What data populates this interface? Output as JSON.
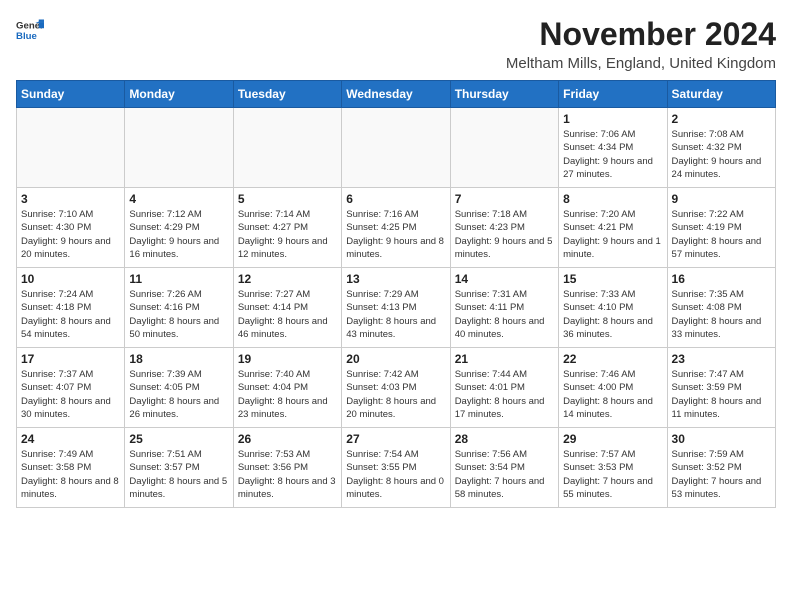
{
  "logo": {
    "text_general": "General",
    "text_blue": "Blue"
  },
  "header": {
    "month": "November 2024",
    "location": "Meltham Mills, England, United Kingdom"
  },
  "days_of_week": [
    "Sunday",
    "Monday",
    "Tuesday",
    "Wednesday",
    "Thursday",
    "Friday",
    "Saturday"
  ],
  "weeks": [
    [
      {
        "day": "",
        "info": ""
      },
      {
        "day": "",
        "info": ""
      },
      {
        "day": "",
        "info": ""
      },
      {
        "day": "",
        "info": ""
      },
      {
        "day": "",
        "info": ""
      },
      {
        "day": "1",
        "info": "Sunrise: 7:06 AM\nSunset: 4:34 PM\nDaylight: 9 hours and 27 minutes."
      },
      {
        "day": "2",
        "info": "Sunrise: 7:08 AM\nSunset: 4:32 PM\nDaylight: 9 hours and 24 minutes."
      }
    ],
    [
      {
        "day": "3",
        "info": "Sunrise: 7:10 AM\nSunset: 4:30 PM\nDaylight: 9 hours and 20 minutes."
      },
      {
        "day": "4",
        "info": "Sunrise: 7:12 AM\nSunset: 4:29 PM\nDaylight: 9 hours and 16 minutes."
      },
      {
        "day": "5",
        "info": "Sunrise: 7:14 AM\nSunset: 4:27 PM\nDaylight: 9 hours and 12 minutes."
      },
      {
        "day": "6",
        "info": "Sunrise: 7:16 AM\nSunset: 4:25 PM\nDaylight: 9 hours and 8 minutes."
      },
      {
        "day": "7",
        "info": "Sunrise: 7:18 AM\nSunset: 4:23 PM\nDaylight: 9 hours and 5 minutes."
      },
      {
        "day": "8",
        "info": "Sunrise: 7:20 AM\nSunset: 4:21 PM\nDaylight: 9 hours and 1 minute."
      },
      {
        "day": "9",
        "info": "Sunrise: 7:22 AM\nSunset: 4:19 PM\nDaylight: 8 hours and 57 minutes."
      }
    ],
    [
      {
        "day": "10",
        "info": "Sunrise: 7:24 AM\nSunset: 4:18 PM\nDaylight: 8 hours and 54 minutes."
      },
      {
        "day": "11",
        "info": "Sunrise: 7:26 AM\nSunset: 4:16 PM\nDaylight: 8 hours and 50 minutes."
      },
      {
        "day": "12",
        "info": "Sunrise: 7:27 AM\nSunset: 4:14 PM\nDaylight: 8 hours and 46 minutes."
      },
      {
        "day": "13",
        "info": "Sunrise: 7:29 AM\nSunset: 4:13 PM\nDaylight: 8 hours and 43 minutes."
      },
      {
        "day": "14",
        "info": "Sunrise: 7:31 AM\nSunset: 4:11 PM\nDaylight: 8 hours and 40 minutes."
      },
      {
        "day": "15",
        "info": "Sunrise: 7:33 AM\nSunset: 4:10 PM\nDaylight: 8 hours and 36 minutes."
      },
      {
        "day": "16",
        "info": "Sunrise: 7:35 AM\nSunset: 4:08 PM\nDaylight: 8 hours and 33 minutes."
      }
    ],
    [
      {
        "day": "17",
        "info": "Sunrise: 7:37 AM\nSunset: 4:07 PM\nDaylight: 8 hours and 30 minutes."
      },
      {
        "day": "18",
        "info": "Sunrise: 7:39 AM\nSunset: 4:05 PM\nDaylight: 8 hours and 26 minutes."
      },
      {
        "day": "19",
        "info": "Sunrise: 7:40 AM\nSunset: 4:04 PM\nDaylight: 8 hours and 23 minutes."
      },
      {
        "day": "20",
        "info": "Sunrise: 7:42 AM\nSunset: 4:03 PM\nDaylight: 8 hours and 20 minutes."
      },
      {
        "day": "21",
        "info": "Sunrise: 7:44 AM\nSunset: 4:01 PM\nDaylight: 8 hours and 17 minutes."
      },
      {
        "day": "22",
        "info": "Sunrise: 7:46 AM\nSunset: 4:00 PM\nDaylight: 8 hours and 14 minutes."
      },
      {
        "day": "23",
        "info": "Sunrise: 7:47 AM\nSunset: 3:59 PM\nDaylight: 8 hours and 11 minutes."
      }
    ],
    [
      {
        "day": "24",
        "info": "Sunrise: 7:49 AM\nSunset: 3:58 PM\nDaylight: 8 hours and 8 minutes."
      },
      {
        "day": "25",
        "info": "Sunrise: 7:51 AM\nSunset: 3:57 PM\nDaylight: 8 hours and 5 minutes."
      },
      {
        "day": "26",
        "info": "Sunrise: 7:53 AM\nSunset: 3:56 PM\nDaylight: 8 hours and 3 minutes."
      },
      {
        "day": "27",
        "info": "Sunrise: 7:54 AM\nSunset: 3:55 PM\nDaylight: 8 hours and 0 minutes."
      },
      {
        "day": "28",
        "info": "Sunrise: 7:56 AM\nSunset: 3:54 PM\nDaylight: 7 hours and 58 minutes."
      },
      {
        "day": "29",
        "info": "Sunrise: 7:57 AM\nSunset: 3:53 PM\nDaylight: 7 hours and 55 minutes."
      },
      {
        "day": "30",
        "info": "Sunrise: 7:59 AM\nSunset: 3:52 PM\nDaylight: 7 hours and 53 minutes."
      }
    ]
  ]
}
